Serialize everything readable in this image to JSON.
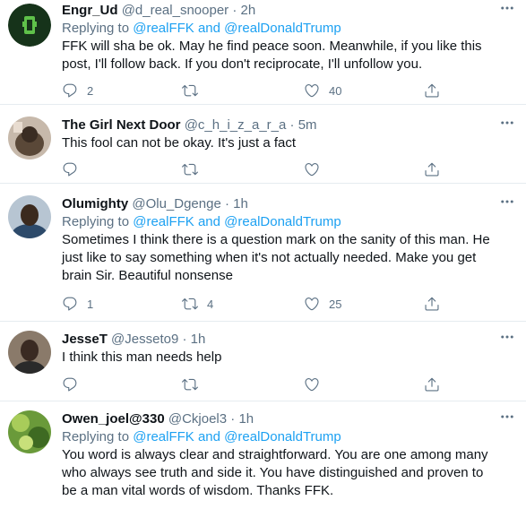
{
  "tweets": [
    {
      "name": "Engr_Ud",
      "handle": "@d_real_snooper",
      "dot": "·",
      "time": "2h",
      "replying_prefix": "Replying to",
      "mention1": "@realFFK",
      "and": "and",
      "mention2": "@realDonaldTrump",
      "text": "FFK will sha be ok. May he find peace soon. Meanwhile, if you like this post, I'll follow back. If you don't reciprocate, I'll unfollow you.",
      "replies": "2",
      "retweets": "",
      "likes": "40",
      "avatar_colors": [
        "#1a3a1a",
        "#6fcf5a"
      ]
    },
    {
      "name": "The Girl Next Door",
      "handle": "@c_h_i_z_a_r_a",
      "dot": "·",
      "time": "5m",
      "text": "This fool can not be okay. It's just a fact",
      "replies": "",
      "retweets": "",
      "likes": "",
      "avatar_colors": [
        "#7a6a5a",
        "#c9b8a8"
      ]
    },
    {
      "name": "Olumighty",
      "handle": "@Olu_Dgenge",
      "dot": "·",
      "time": "1h",
      "replying_prefix": "Replying to",
      "mention1": "@realFFK",
      "and": "and",
      "mention2": "@realDonaldTrump",
      "text": "Sometimes I think there is a question mark on the sanity of this man. He just like to say something when it's not actually needed. Make you get brain Sir. Beautiful nonsense",
      "replies": "1",
      "retweets": "4",
      "likes": "25",
      "avatar_colors": [
        "#3b2a1e",
        "#a7b9c9"
      ]
    },
    {
      "name": "JesseT",
      "handle": "@Jesseto9",
      "dot": "·",
      "time": "1h",
      "text": "I think this man needs help",
      "replies": "",
      "retweets": "",
      "likes": "",
      "avatar_colors": [
        "#2e2420",
        "#8a7a6a"
      ]
    },
    {
      "name": "Owen_joel@330",
      "handle": "@Ckjoel3",
      "dot": "·",
      "time": "1h",
      "replying_prefix": "Replying to",
      "mention1": "@realFFK",
      "and": "and",
      "mention2": "@realDonaldTrump",
      "text": "You word is always clear and straightforward. You are one among many who always see truth and side it. You have distinguished and proven to be a man vital words of wisdom. Thanks FFK.",
      "avatar_colors": [
        "#4a7a2a",
        "#b8d86a"
      ]
    }
  ],
  "icons": {
    "more": "more-icon",
    "reply": "reply-icon",
    "retweet": "retweet-icon",
    "like": "like-icon",
    "share": "share-icon"
  },
  "colors": {
    "mention": "#1da1f2",
    "secondary": "#5b7083",
    "border": "#e6ecf0"
  }
}
